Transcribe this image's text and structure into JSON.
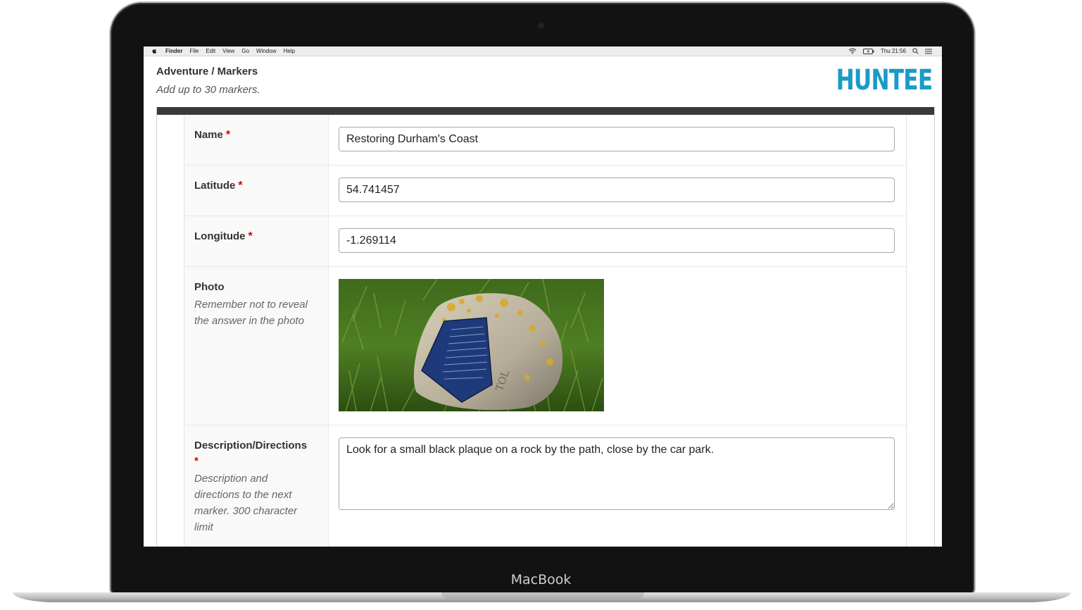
{
  "device": {
    "brand": "MacBook"
  },
  "menubar": {
    "apple_icon": "apple-icon",
    "items": [
      "Finder",
      "File",
      "Edit",
      "View",
      "Go",
      "Window",
      "Help"
    ],
    "clock": "Thu 21:56",
    "status_icons": [
      "wifi-icon",
      "battery-icon",
      "search-icon",
      "list-icon"
    ]
  },
  "header": {
    "title": "Adventure / Markers",
    "subtitle": "Add up to 30 markers.",
    "logo": "HUNTEE"
  },
  "form": {
    "name": {
      "label": "Name",
      "required_mark": "*",
      "value": "Restoring Durham's Coast"
    },
    "latitude": {
      "label": "Latitude",
      "required_mark": "*",
      "value": "54.741457"
    },
    "longitude": {
      "label": "Longitude",
      "required_mark": "*",
      "value": "-1.269114"
    },
    "photo": {
      "label": "Photo",
      "hint": "Remember not to reveal the answer in the photo"
    },
    "description": {
      "label": "Description/Directions",
      "required_mark": "*",
      "hint": "Description and directions to the next marker. 300 character limit",
      "value": "Look for a small black plaque on a rock by the path, close by the car park."
    }
  },
  "colors": {
    "logo": "#1a9bc7",
    "required": "#d40000",
    "panel_bar": "#3b3a38"
  }
}
